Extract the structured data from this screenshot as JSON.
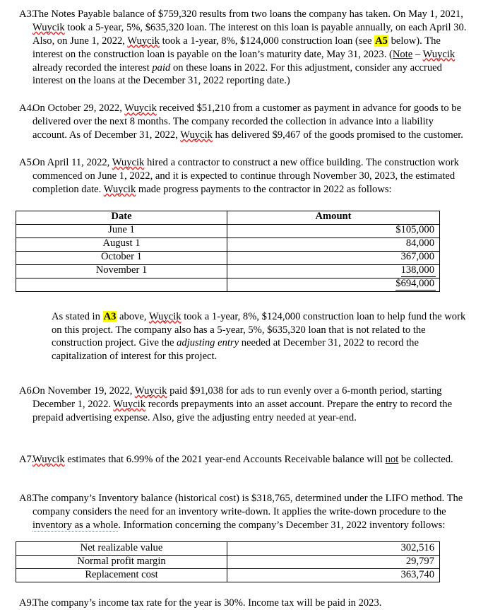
{
  "document": {
    "type": "accounting-exam-worksheet",
    "company": "Wuycik",
    "highlight_color": "#ffff00"
  },
  "items": [
    {
      "label": "A3.",
      "text_runs": [
        {
          "t": "The Notes Payable balance of $759,320 results from two loans the company has taken. On May 1, 2021, "
        },
        {
          "t": "Wuycik",
          "style": "spell"
        },
        {
          "t": " took a 5-year, 5%, $635,320 loan. The interest on this loan is payable annually, on each April 30. Also, on June 1, 2022, "
        },
        {
          "t": "Wuycik",
          "style": "spell"
        },
        {
          "t": " took a 1-year, 8%, $124,000 construction loan (see "
        },
        {
          "t": "A5",
          "style": "highlight"
        },
        {
          "t": " below). The interest on the construction loan is payable on the loan’s maturity date, May 31, 2023. ("
        },
        {
          "t": "Note",
          "style": "underline"
        },
        {
          "t": " – "
        },
        {
          "t": "Wuycik",
          "style": "spell"
        },
        {
          "t": " already recorded the interest "
        },
        {
          "t": "paid",
          "style": "italic"
        },
        {
          "t": " on these loans in 2022. For this adjustment, consider any accrued interest on the loans at the December 31, 2022 reporting date.)"
        }
      ]
    },
    {
      "label": "A4.",
      "text_runs": [
        {
          "t": "On October 29, 2022, "
        },
        {
          "t": "Wuycik",
          "style": "spell"
        },
        {
          "t": " received $51,210 from a customer as payment in advance for goods to be delivered over the next 8 months. The company recorded the collection in advance into a liability account. As of December 31, 2022, "
        },
        {
          "t": "Wuycik",
          "style": "spell"
        },
        {
          "t": " has delivered $9,467 of the goods promised to the customer."
        }
      ]
    },
    {
      "label": "A5.",
      "text_runs": [
        {
          "t": "On April 11, 2022, "
        },
        {
          "t": "Wuycik",
          "style": "spell"
        },
        {
          "t": " hired a contractor to construct a new office building. The construction work commenced on June 1, 2022, and it is expected to continue through November 30, 2023, the estimated completion date. "
        },
        {
          "t": "Wuycik",
          "style": "spell"
        },
        {
          "t": " made progress payments to the contractor in 2022 as follows:"
        }
      ]
    },
    {
      "label": "A6.",
      "text_runs": [
        {
          "t": "On November 19, 2022, "
        },
        {
          "t": "Wuycik",
          "style": "spell"
        },
        {
          "t": " paid $91,038 for ads to run evenly over a 6-month period, starting December 1, 2022. "
        },
        {
          "t": "Wuycik",
          "style": "spell"
        },
        {
          "t": " records prepayments into an asset account. Prepare the entry to record the prepaid advertising expense. Also, give the adjusting entry needed at year-end."
        }
      ]
    },
    {
      "label": "A7.",
      "text_runs": [
        {
          "t": "Wuycik",
          "style": "spell"
        },
        {
          "t": " estimates that 6.99% of the 2021 year-end Accounts Receivable balance will "
        },
        {
          "t": "not",
          "style": "underline"
        },
        {
          "t": " be collected."
        }
      ]
    },
    {
      "label": "A8.",
      "text_runs": [
        {
          "t": "The company’s Inventory balance (historical cost) is $318,765, determined under the LIFO method. The company considers the need for an inventory write-down. It applies the write-down procedure to the "
        },
        {
          "t": "inventory as a whole",
          "style": "grammar"
        },
        {
          "t": ". Information concerning the company’s December 31, 2022 inventory follows:"
        }
      ]
    },
    {
      "label": "A9.",
      "text_runs": [
        {
          "t": "The company’s income tax rate for the year is 30%. Income tax will be paid in 2023."
        }
      ]
    }
  ],
  "progress_payments_table": {
    "headers": [
      "Date",
      "Amount"
    ],
    "rows": [
      {
        "date": "June 1",
        "amount": "$105,000",
        "rule": "none"
      },
      {
        "date": "August 1",
        "amount": "84,000",
        "rule": "none"
      },
      {
        "date": "October 1",
        "amount": "367,000",
        "rule": "none"
      },
      {
        "date": "November 1",
        "amount": "138,000",
        "rule": "single"
      }
    ],
    "total_row": {
      "date": "",
      "amount": "$694,000",
      "rule": "double"
    }
  },
  "post_table_paragraph": {
    "text_runs": [
      {
        "t": "As stated in "
      },
      {
        "t": "A3",
        "style": "highlight"
      },
      {
        "t": " above, "
      },
      {
        "t": "Wuycik",
        "style": "spell"
      },
      {
        "t": " took a 1-year, 8%, $124,000 construction loan to help fund the work on this project. The company also has a 5-year, 5%, $635,320 loan that is not related to the construction project. Give the "
      },
      {
        "t": "adjusting entry",
        "style": "italic"
      },
      {
        "t": " needed at December 31, 2022 to record the capitalization of interest for this project."
      }
    ]
  },
  "inventory_table": {
    "rows": [
      {
        "label": "Net realizable value",
        "value": "302,516"
      },
      {
        "label": "Normal profit margin",
        "value": "29,797"
      },
      {
        "label": "Replacement cost",
        "value": "363,740"
      }
    ]
  }
}
